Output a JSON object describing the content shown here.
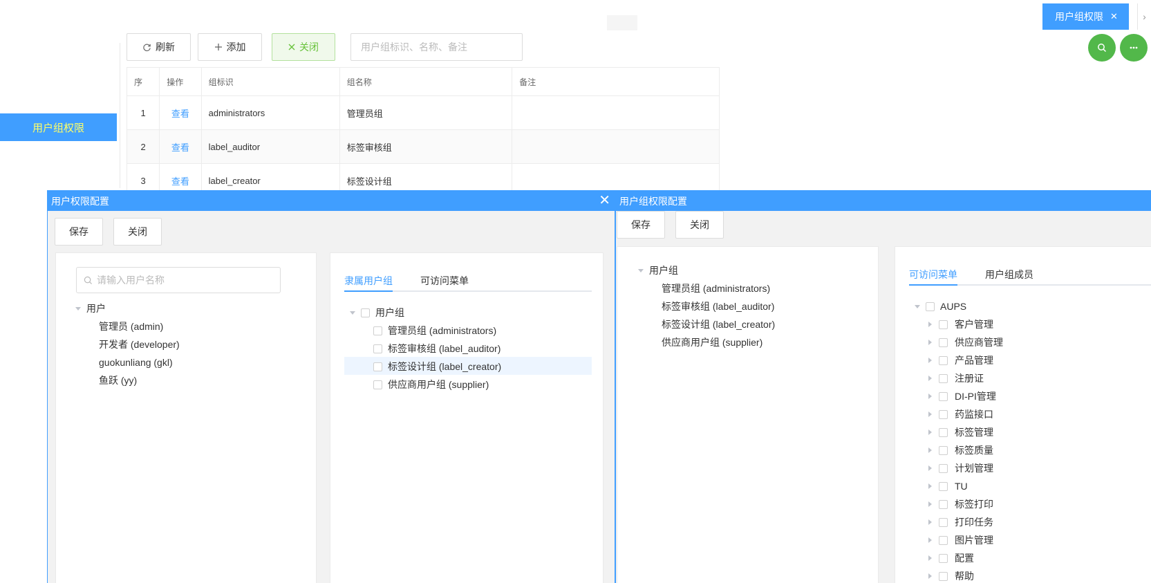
{
  "tabs": {
    "active_label": "用户组权限",
    "close_glyph": "✕",
    "next_glyph": "›"
  },
  "sidebar": {
    "items": [
      {
        "label": "用户组权限"
      }
    ]
  },
  "toolbar": {
    "refresh_label": "刷新",
    "add_label": "添加",
    "close_label": "关闭",
    "search_placeholder": "用户组标识、名称、备注"
  },
  "table": {
    "columns": [
      "序",
      "操作",
      "组标识",
      "组名称",
      "备注"
    ],
    "rows": [
      {
        "index": "1",
        "action": "查看",
        "group_id": "administrators",
        "group_name": "管理员组",
        "remark": ""
      },
      {
        "index": "2",
        "action": "查看",
        "group_id": "label_auditor",
        "group_name": "标签审核组",
        "remark": ""
      },
      {
        "index": "3",
        "action": "查看",
        "group_id": "label_creator",
        "group_name": "标签设计组",
        "remark": ""
      }
    ]
  },
  "dialog_user": {
    "title": "用户权限配置",
    "save_label": "保存",
    "close_label": "关闭",
    "search_placeholder": "请输入用户名称",
    "tree_root": "用户",
    "users": [
      "管理员 (admin)",
      "开发者 (developer)",
      "guokunliang (gkl)",
      "鱼跃 (yy)"
    ],
    "tabs": [
      "隶属用户组",
      "可访问菜单"
    ],
    "group_root": "用户组",
    "groups": [
      "管理员组 (administrators)",
      "标签审核组 (label_auditor)",
      "标签设计组 (label_creator)",
      "供应商用户组 (supplier)"
    ]
  },
  "dialog_group": {
    "title": "用户组权限配置",
    "save_label": "保存",
    "close_label": "关闭",
    "tree_root": "用户组",
    "groups": [
      "管理员组 (administrators)",
      "标签审核组 (label_auditor)",
      "标签设计组 (label_creator)",
      "供应商用户组 (supplier)"
    ],
    "tabs": [
      "可访问菜单",
      "用户组成员"
    ],
    "menu_root": "AUPS",
    "menus": [
      "客户管理",
      "供应商管理",
      "产品管理",
      "注册证",
      "DI-PI管理",
      "药监接口",
      "标签管理",
      "标签质量",
      "计划管理",
      "TU",
      "标签打印",
      "打印任务",
      "图片管理",
      "配置",
      "帮助"
    ]
  },
  "colors": {
    "primary": "#409eff",
    "success": "#52b84a",
    "sidebar_text": "#ffff66"
  }
}
